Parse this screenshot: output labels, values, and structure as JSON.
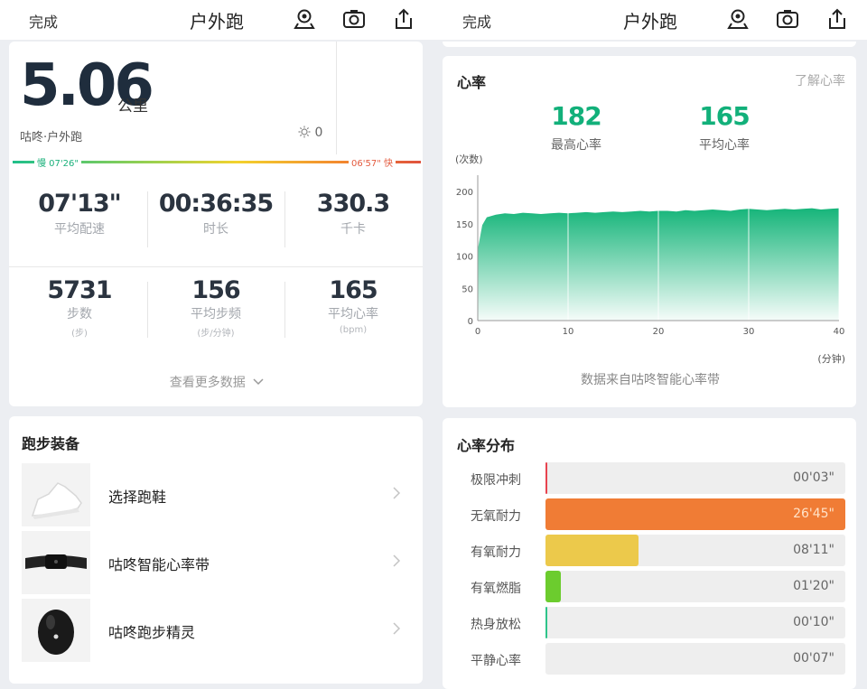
{
  "left": {
    "topbar": {
      "done_label": "完成",
      "title": "户外跑"
    },
    "summary": {
      "distance": "5.06",
      "distance_unit": "公里",
      "run_type": "咕咚·户外跑",
      "weather_value": "0",
      "pace_slow": "慢 07'26\"",
      "pace_fast": "06'57\" 快"
    },
    "stats": [
      {
        "value": "07'13\"",
        "label": "平均配速",
        "unit": ""
      },
      {
        "value": "00:36:35",
        "label": "时长",
        "unit": ""
      },
      {
        "value": "330.3",
        "label": "千卡",
        "unit": ""
      },
      {
        "value": "5731",
        "label": "步数",
        "unit": "(步)"
      },
      {
        "value": "156",
        "label": "平均步频",
        "unit": "(步/分钟)"
      },
      {
        "value": "165",
        "label": "平均心率",
        "unit": "(bpm)"
      }
    ],
    "more_label": "查看更多数据",
    "gear": {
      "title": "跑步装备",
      "items": [
        {
          "name": "选择跑鞋",
          "icon": "shoe-icon"
        },
        {
          "name": "咕咚智能心率带",
          "icon": "heart-rate-strap-icon"
        },
        {
          "name": "咕咚跑步精灵",
          "icon": "running-sprite-icon"
        }
      ]
    }
  },
  "right": {
    "topbar": {
      "done_label": "完成",
      "title": "户外跑"
    },
    "heart": {
      "title": "心率",
      "learn_more": "了解心率",
      "max_value": "182",
      "max_label": "最高心率",
      "avg_value": "165",
      "avg_label": "平均心率",
      "source": "数据来自咕咚智能心率带"
    },
    "zones": {
      "title": "心率分布",
      "items": [
        {
          "label": "极限冲刺",
          "time": "00'03\"",
          "fraction": 0.004,
          "color": "#e8434f"
        },
        {
          "label": "无氧耐力",
          "time": "26'45\"",
          "fraction": 1.0,
          "color": "#f07c35"
        },
        {
          "label": "有氧耐力",
          "time": "08'11\"",
          "fraction": 0.31,
          "color": "#ecc94b"
        },
        {
          "label": "有氧燃脂",
          "time": "01'20\"",
          "fraction": 0.05,
          "color": "#6ccc2e"
        },
        {
          "label": "热身放松",
          "time": "00'10\"",
          "fraction": 0.006,
          "color": "#2ec48a"
        },
        {
          "label": "平静心率",
          "time": "00'07\"",
          "fraction": 0.0,
          "color": "#9bd8e8"
        }
      ]
    }
  },
  "chart_data": {
    "type": "area",
    "title": "",
    "xlabel": "(分钟)",
    "ylabel": "(次数)",
    "xlim": [
      0,
      40
    ],
    "ylim": [
      0,
      200
    ],
    "xticks": [
      0,
      10,
      20,
      30,
      40
    ],
    "yticks": [
      0,
      50,
      100,
      150,
      200
    ],
    "grid": "vertical",
    "series": [
      {
        "color": "#16b57a",
        "x": [
          0,
          0.5,
          1,
          2,
          3,
          4,
          5,
          6,
          7,
          8,
          9,
          10,
          11,
          12,
          13,
          14,
          15,
          16,
          17,
          18,
          19,
          20,
          21,
          22,
          23,
          24,
          25,
          26,
          27,
          28,
          29,
          30,
          31,
          32,
          33,
          34,
          35,
          36,
          37,
          38,
          39,
          40
        ],
        "y": [
          110,
          148,
          160,
          164,
          166,
          165,
          167,
          166,
          165,
          166,
          167,
          166,
          167,
          168,
          167,
          168,
          169,
          168,
          169,
          170,
          169,
          170,
          170,
          169,
          171,
          170,
          171,
          172,
          171,
          170,
          172,
          173,
          172,
          171,
          172,
          173,
          172,
          173,
          174,
          172,
          173,
          174
        ]
      }
    ]
  }
}
